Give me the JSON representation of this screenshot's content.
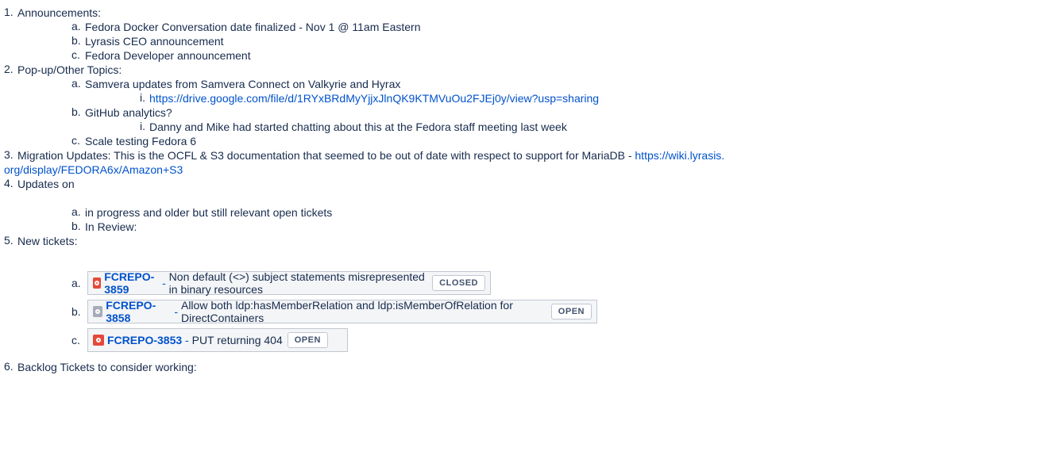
{
  "items": {
    "i1": {
      "num": "1.",
      "text": "Announcements:"
    },
    "i1a": {
      "num": "a.",
      "text": "Fedora Docker Conversation date finalized - Nov 1 @ 11am Eastern"
    },
    "i1b": {
      "num": "b.",
      "text": "Lyrasis CEO announcement"
    },
    "i1c": {
      "num": "c.",
      "text": "Fedora Developer announcement"
    },
    "i2": {
      "num": "2.",
      "text": "Pop-up/Other Topics:"
    },
    "i2a": {
      "num": "a.",
      "text": "Samvera updates from Samvera Connect on Valkyrie and Hyrax"
    },
    "i2ai": {
      "num": "i.",
      "link": "https://drive.google.com/file/d/1RYxBRdMyYjjxJlnQK9KTMVuOu2FJEj0y/view?usp=sharing"
    },
    "i2b": {
      "num": "b.",
      "text": "GitHub analytics?"
    },
    "i2bi": {
      "num": "i.",
      "text": "Danny and Mike had started chatting about this at the Fedora staff meeting last week"
    },
    "i2c": {
      "num": "c.",
      "text": "Scale testing Fedora 6"
    },
    "i3": {
      "num": "3.",
      "text": "Migration Updates:  This is the OCFL & S3 documentation that seemed to be out of date with respect to support for MariaDB - ",
      "link_part1": "https://wiki.lyrasis.",
      "link_part2": "org/display/FEDORA6x/Amazon+S3"
    },
    "i4": {
      "num": "4.",
      "text": "Updates on"
    },
    "i4a": {
      "num": "a.",
      "text": "in progress and older but still relevant open tickets"
    },
    "i4b": {
      "num": "b.",
      "text": "In Review:"
    },
    "i5": {
      "num": "5.",
      "text": "New tickets:"
    },
    "i6": {
      "num": "6.",
      "text": "Backlog Tickets to consider working:"
    }
  },
  "tickets": [
    {
      "num": "a.",
      "key": "FCREPO-3859",
      "sep": " - ",
      "summary": "Non default (<>) subject statements misrepresented in binary resources",
      "status": "CLOSED",
      "icon": "bug-icon",
      "icon_color": "#e5493a"
    },
    {
      "num": "b.",
      "key": "FCREPO-3858",
      "sep": " - ",
      "summary": "Allow both ldp:hasMemberRelation and ldp:isMemberOfRelation for DirectContainers",
      "status": "OPEN",
      "icon": "task-icon",
      "icon_color": "#a5adba"
    },
    {
      "num": "c.",
      "key": "FCREPO-3853",
      "sep": " - ",
      "summary": "PUT returning 404",
      "status": "OPEN",
      "icon": "bug-icon",
      "icon_color": "#e5493a"
    }
  ]
}
